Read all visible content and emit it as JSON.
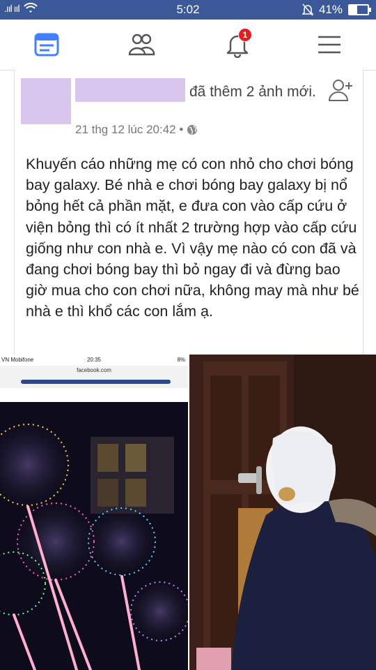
{
  "status_bar": {
    "signal": ".ııl ııl",
    "time": "5:02",
    "battery": "41%",
    "battery_level": 0.41
  },
  "nav": {
    "notification_count": "1"
  },
  "post": {
    "action_text": "đã thêm 2 ảnh mới.",
    "timestamp": "21 thg 12 lúc 20:42 •",
    "body": "Khuyến cáo những mẹ có con nhỏ cho chơi bóng bay galaxy. Bé nhà e chơi bóng bay galaxy bị nổ bỏng hết cả phần mặt, e đưa con vào cấp cứu ở viện bỏng thì có ít nhất 2 trường hợp vào cấp cứu giống như con nhà e. Vì vậy mẹ nào có con đã và đang chơi bóng bay thì bỏ ngay đi và đừng bao giờ mua cho con chơi nữa, không may mà như bé nhà e thì khổ các con lắm ạ."
  },
  "photo_left": {
    "carrier": "VN Mobifone",
    "time": "20:35",
    "battery": "8%",
    "url": "facebook.com"
  },
  "colors": {
    "brand": "#3b5998",
    "active_icon": "#4080ff",
    "badge": "#e02020"
  }
}
